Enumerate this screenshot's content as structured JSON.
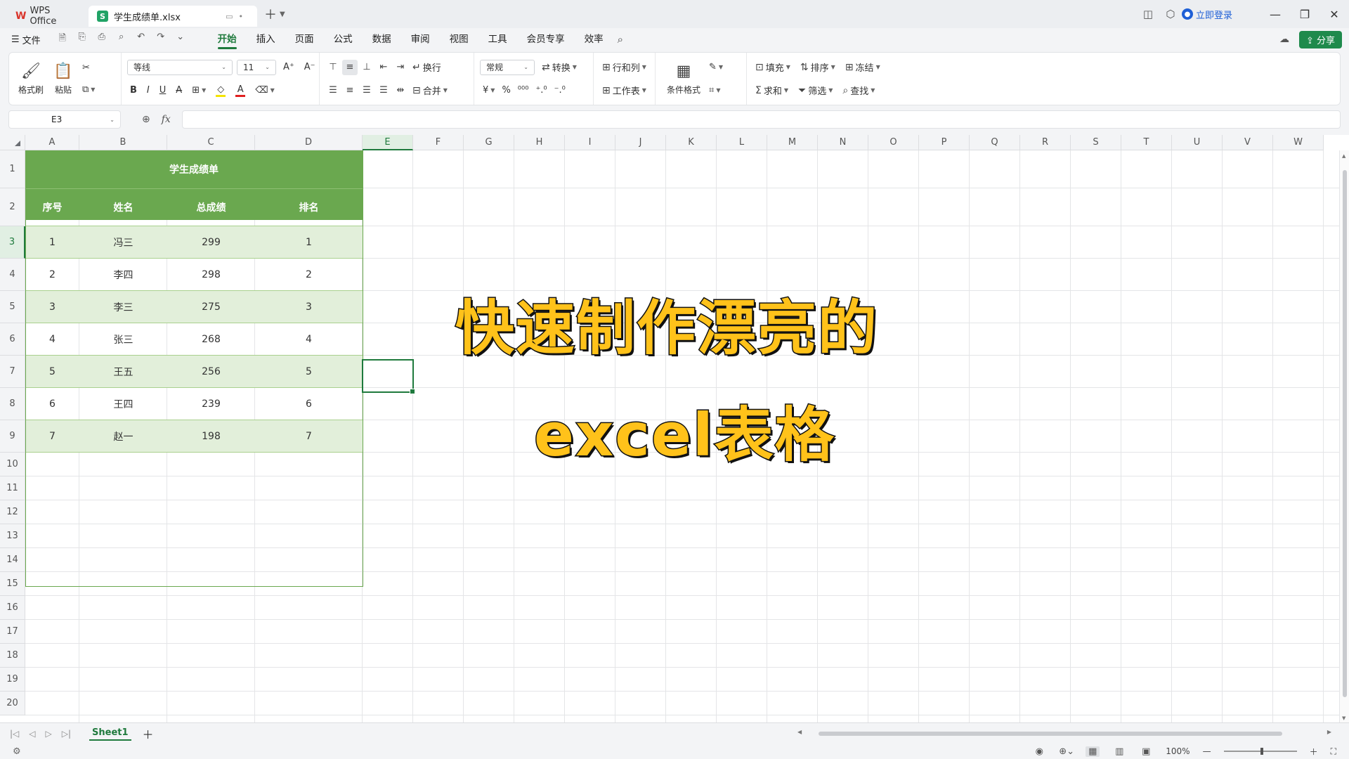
{
  "titlebar": {
    "app_tab": "WPS Office",
    "file_tab": "学生成绩单.xlsx",
    "login": "立即登录"
  },
  "menubar": {
    "file_label": "文件",
    "tabs": [
      "开始",
      "插入",
      "页面",
      "公式",
      "数据",
      "审阅",
      "视图",
      "工具",
      "会员专享",
      "效率"
    ],
    "active_tab": "开始",
    "share": "分享"
  },
  "ribbon": {
    "format_painter": "格式刷",
    "paste": "粘贴",
    "font_name": "等线",
    "font_size": "11",
    "wrap": "换行",
    "merge": "合并",
    "number_format": "常规",
    "convert": "转换",
    "row_col": "行和列",
    "worksheet": "工作表",
    "cond_format": "条件格式",
    "fill": "填充",
    "sort": "排序",
    "freeze": "冻结",
    "sum": "求和",
    "filter": "筛选",
    "find": "查找",
    "currency_symbol": "¥",
    "percent_symbol": "%"
  },
  "formulabar": {
    "cell_ref": "E3",
    "fx": "fx",
    "formula": ""
  },
  "grid": {
    "columns": [
      "A",
      "B",
      "C",
      "D",
      "E",
      "F",
      "G",
      "H",
      "I",
      "J",
      "K",
      "L",
      "M",
      "N",
      "O",
      "P",
      "Q",
      "R",
      "S",
      "T",
      "U",
      "V",
      "W"
    ],
    "rows": [
      "1",
      "2",
      "3",
      "4",
      "5",
      "6",
      "7",
      "8",
      "9",
      "10",
      "11",
      "12",
      "13",
      "14",
      "15",
      "16",
      "17",
      "18",
      "19",
      "20"
    ],
    "selected_cell": "E3"
  },
  "table": {
    "title": "学生成绩单",
    "headers": [
      "序号",
      "姓名",
      "总成绩",
      "排名"
    ],
    "rows": [
      [
        "1",
        "冯三",
        "299",
        "1"
      ],
      [
        "2",
        "李四",
        "298",
        "2"
      ],
      [
        "3",
        "李三",
        "275",
        "3"
      ],
      [
        "4",
        "张三",
        "268",
        "4"
      ],
      [
        "5",
        "王五",
        "256",
        "5"
      ],
      [
        "6",
        "王四",
        "239",
        "6"
      ],
      [
        "7",
        "赵一",
        "198",
        "7"
      ]
    ],
    "header_color": "#6aa84f",
    "stripe_color": "#e2efda"
  },
  "overlay": {
    "line1": "快速制作漂亮的",
    "line2": "excel表格",
    "text_color": "#ffc21a"
  },
  "sheetbar": {
    "sheet_name": "Sheet1"
  },
  "statusbar": {
    "zoom": "100%"
  }
}
